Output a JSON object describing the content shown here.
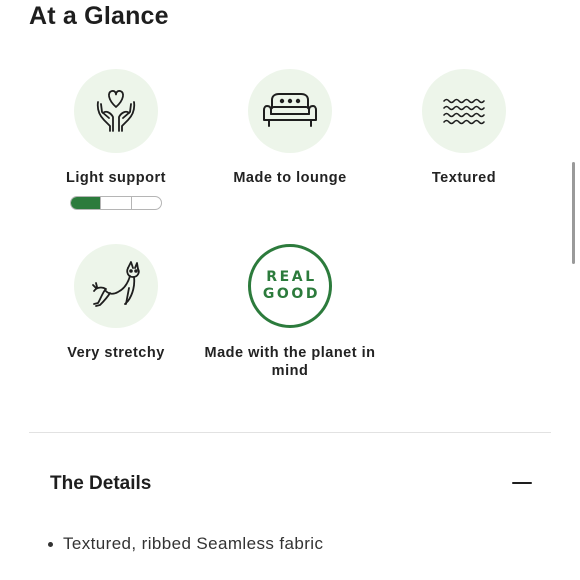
{
  "section_title": "At a Glance",
  "features": [
    {
      "label": "Light support",
      "icon": "hands-heart-icon"
    },
    {
      "label": "Made to lounge",
      "icon": "sofa-icon"
    },
    {
      "label": "Textured",
      "icon": "wavy-lines-icon"
    },
    {
      "label": "Very stretchy",
      "icon": "stretching-cat-icon"
    },
    {
      "label": "Made with the planet in mind",
      "icon": "real-good-badge"
    }
  ],
  "support_level": {
    "filled_segments": 1,
    "total_segments": 3
  },
  "badge": {
    "line1": "REAL",
    "line2": "GOOD"
  },
  "details": {
    "title": "The Details",
    "toggle_icon": "minus-icon",
    "items": [
      "Textured, ribbed Seamless fabric"
    ]
  },
  "colors": {
    "accent_green": "#2c7b3c",
    "icon_circle_bg": "#edf5ea",
    "text": "#1e1e1e"
  }
}
